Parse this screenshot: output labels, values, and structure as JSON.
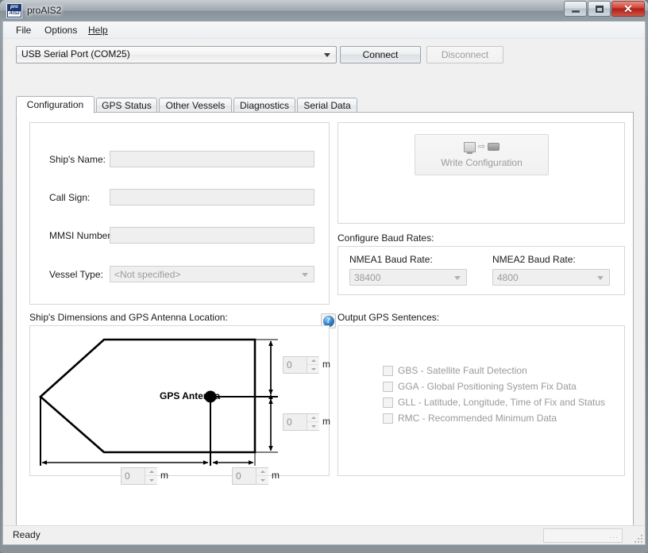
{
  "window": {
    "title": "proAIS2",
    "app_icon_line1": "pro",
    "app_icon_line2": "AIS2",
    "minimize_label": "Minimize",
    "maximize_label": "Maximize",
    "close_label": "Close",
    "close_glyph": "✕"
  },
  "menubar": {
    "items": [
      {
        "label": "File"
      },
      {
        "label": "Options"
      },
      {
        "label": "Help"
      }
    ]
  },
  "toolbar": {
    "port_value": "USB Serial Port (COM25)",
    "connect_label": "Connect",
    "disconnect_label": "Disconnect"
  },
  "tabs": [
    {
      "label": "Configuration",
      "active": true
    },
    {
      "label": "GPS Status",
      "active": false
    },
    {
      "label": "Other Vessels",
      "active": false
    },
    {
      "label": "Diagnostics",
      "active": false
    },
    {
      "label": "Serial Data",
      "active": false
    }
  ],
  "ship_details": {
    "ship_name_label": "Ship's Name:",
    "ship_name_value": "",
    "call_sign_label": "Call Sign:",
    "call_sign_value": "",
    "mmsi_label": "MMSI Number:",
    "mmsi_value": "",
    "mmsi_help_glyph": "?",
    "vessel_type_label": "Vessel Type:",
    "vessel_type_value": "<Not specified>"
  },
  "write_config": {
    "label": "Write Configuration",
    "icon_arrow": "⇨"
  },
  "baud": {
    "group_label": "Configure Baud Rates:",
    "nmea1_label": "NMEA1 Baud Rate:",
    "nmea1_value": "38400",
    "nmea2_label": "NMEA2 Baud Rate:",
    "nmea2_value": "4800"
  },
  "dimensions": {
    "group_label": "Ship's Dimensions and GPS Antenna Location:",
    "antenna_label": "GPS Antenna",
    "unit": "m",
    "fields": [
      {
        "name": "to-port",
        "value": "0"
      },
      {
        "name": "to-starboard",
        "value": "0"
      },
      {
        "name": "to-bow",
        "value": "0"
      },
      {
        "name": "to-stern",
        "value": "0"
      }
    ]
  },
  "gps_sentences": {
    "group_label": "Output GPS Sentences:",
    "items": [
      {
        "label": "GBS - Satellite Fault Detection",
        "checked": false
      },
      {
        "label": "GGA - Global Positioning System Fix Data",
        "checked": false
      },
      {
        "label": "GLL - Latitude, Longitude, Time of Fix and Status",
        "checked": false
      },
      {
        "label": "RMC - Recommended Minimum Data",
        "checked": false
      }
    ]
  },
  "statusbar": {
    "text": "Ready",
    "panel_dots": "···"
  },
  "colors": {
    "accent": "#1b3a73",
    "close_red": "#c0392b",
    "panel_bg": "#f0f0f0",
    "disabled_text": "#9a9a9a"
  }
}
